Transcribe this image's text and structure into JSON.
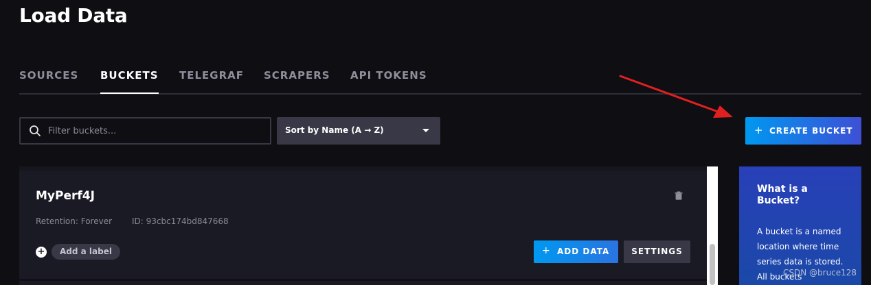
{
  "page": {
    "title": "Load Data"
  },
  "tabs": [
    {
      "label": "SOURCES",
      "active": false
    },
    {
      "label": "BUCKETS",
      "active": true
    },
    {
      "label": "TELEGRAF",
      "active": false
    },
    {
      "label": "SCRAPERS",
      "active": false
    },
    {
      "label": "API TOKENS",
      "active": false
    }
  ],
  "toolbar": {
    "search_placeholder": "Filter buckets...",
    "search_value": "",
    "sort_label": "Sort by Name (A → Z)",
    "create_label": "CREATE BUCKET",
    "create_icon": "plus-icon"
  },
  "bucket": {
    "name": "MyPerf4J",
    "retention": "Retention: Forever",
    "id": "ID: 93cbc174bd847668",
    "add_label": "Add a label",
    "add_data": "ADD DATA",
    "settings": "SETTINGS"
  },
  "help": {
    "title": "What is a Bucket?",
    "body": "A bucket is a named location where time series data is stored. All buckets"
  },
  "watermark": "CSDN @bruce128",
  "colors": {
    "background": "#0e0e13",
    "accent_start": "#0098f0",
    "accent_end": "#3e4fd6",
    "annotation_arrow": "#e02020"
  }
}
